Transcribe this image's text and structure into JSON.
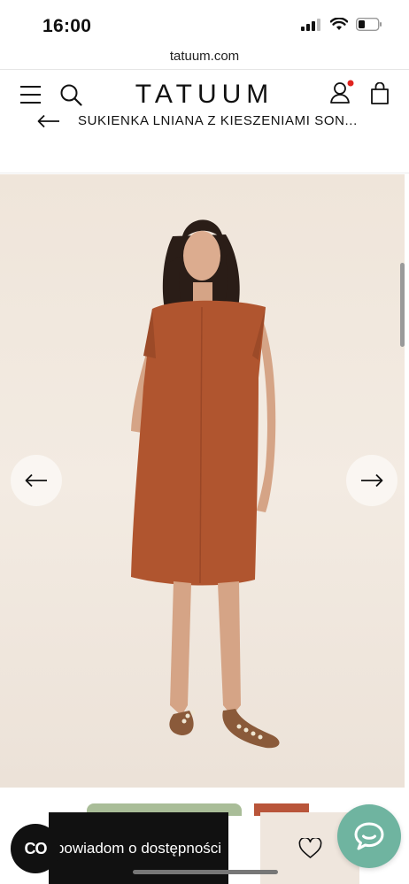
{
  "status_bar": {
    "time": "16:00"
  },
  "browser": {
    "url": "tatuum.com"
  },
  "header": {
    "logo": "TATUUM"
  },
  "product": {
    "title": "SUKIENKA LNIANA Z KIESZENIAMI SON..."
  },
  "actions": {
    "notify_label": "powiadom o dostępności",
    "brand_badge": "CO"
  },
  "colors": {
    "dress": "#b0552f",
    "accent_dot": "#e0231f",
    "chat": "#6fb4a0",
    "swatch_green": "#a9bd98",
    "swatch_rust": "#b9553a"
  }
}
